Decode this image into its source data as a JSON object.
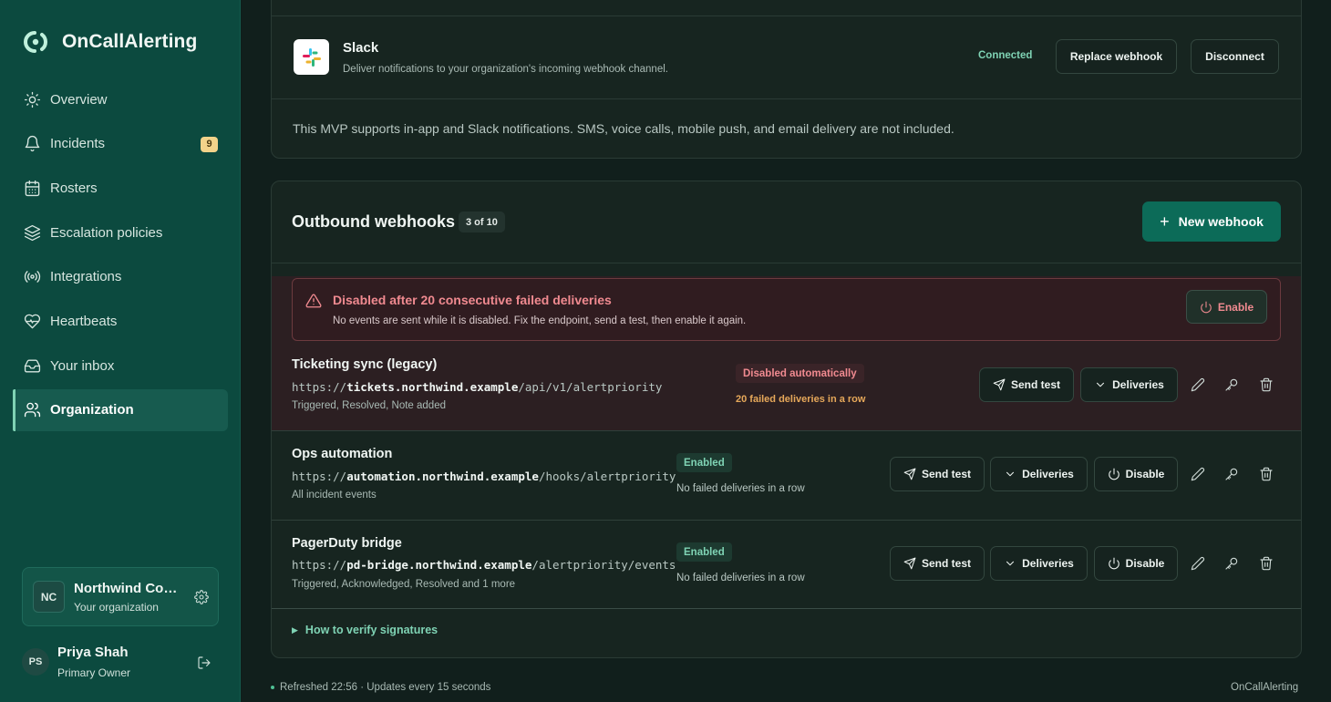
{
  "app": {
    "name": "OnCallAlerting",
    "accent": "#7fd3b4",
    "brand_bg": "#0c4a3f"
  },
  "sidebar": {
    "items": [
      {
        "label": "Overview",
        "icon": "sun-icon"
      },
      {
        "label": "Incidents",
        "icon": "bell-icon",
        "badge": "9"
      },
      {
        "label": "Rosters",
        "icon": "calendar-icon"
      },
      {
        "label": "Escalation policies",
        "icon": "layers-icon"
      },
      {
        "label": "Integrations",
        "icon": "broadcast-icon"
      },
      {
        "label": "Heartbeats",
        "icon": "heart-pulse-icon"
      },
      {
        "label": "Your inbox",
        "icon": "inbox-icon"
      },
      {
        "label": "Organization",
        "icon": "users-icon",
        "active": true
      }
    ],
    "org": {
      "initials": "NC",
      "name": "Northwind Com...",
      "subtitle": "Your organization"
    },
    "user": {
      "initials": "PS",
      "name": "Priya Shah",
      "role": "Primary Owner"
    }
  },
  "slack": {
    "title": "Slack",
    "description": "Deliver notifications to your organization's incoming webhook channel.",
    "status": "Connected",
    "replace_label": "Replace webhook",
    "disconnect_label": "Disconnect",
    "note": "This MVP supports in-app and Slack notifications. SMS, voice calls, mobile push, and email delivery are not included."
  },
  "webhooks": {
    "title": "Outbound webhooks",
    "count": "3 of 10",
    "new_label": "New webhook",
    "alert": {
      "title": "Disabled after 20 consecutive failed deliveries",
      "description": "No events are sent while it is disabled. Fix the endpoint, send a test, then enable it again.",
      "enable_label": "Enable"
    },
    "rows": [
      {
        "name": "Ticketing sync (legacy)",
        "url_prefix": "https://",
        "url_host": "tickets.northwind.example",
        "url_path": "/api/v1/alertpriority",
        "events": "Triggered, Resolved, Note added",
        "status": "Disabled automatically",
        "detail": "20 failed deliveries in a row",
        "send_test": "Send test",
        "deliveries": "Deliveries"
      },
      {
        "name": "Ops automation",
        "url_prefix": "https://",
        "url_host": "automation.northwind.example",
        "url_path": "/hooks/alertpriority",
        "events": "All incident events",
        "status": "Enabled",
        "detail": "No failed deliveries in a row",
        "send_test": "Send test",
        "deliveries": "Deliveries",
        "disable": "Disable"
      },
      {
        "name": "PagerDuty bridge",
        "url_prefix": "https://",
        "url_host": "pd-bridge.northwind.example",
        "url_path": "/alertpriority/events",
        "events": "Triggered, Acknowledged, Resolved and 1 more",
        "status": "Enabled",
        "detail": "No failed deliveries in a row",
        "send_test": "Send test",
        "deliveries": "Deliveries",
        "disable": "Disable"
      }
    ],
    "verify_label": "How to verify signatures"
  },
  "footer": {
    "refreshed": "Refreshed 22:56 · Updates every 15 seconds",
    "brand": "OnCallAlerting"
  }
}
